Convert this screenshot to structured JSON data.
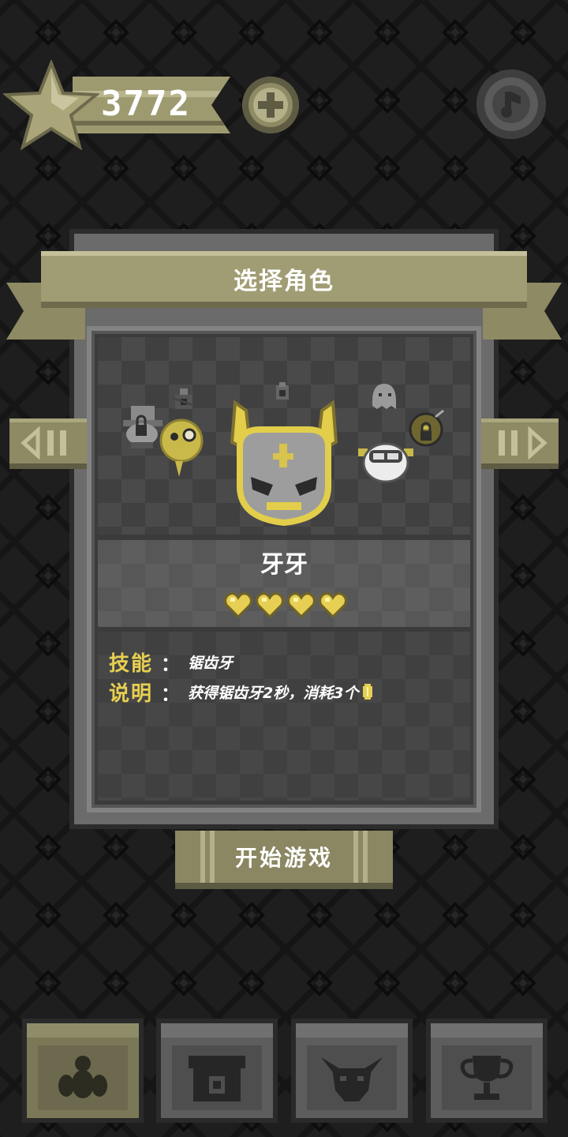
{
  "score": "3772",
  "dialog": {
    "title": "选择角色",
    "character_name": "牙牙",
    "hearts": 4,
    "skill_label": "技能",
    "skill_colon": "：",
    "skill_value": "锯齿牙",
    "desc_label": "说明",
    "desc_colon": "：",
    "desc_value": "获得锯齿牙2秒，消耗3个"
  },
  "start_button": "开始游戏",
  "icons": {
    "score": "star-icon",
    "add": "plus-icon",
    "sound": "sound-icon",
    "prev": "prev-arrow-icon",
    "next": "next-arrow-icon",
    "coin": "coin-icon",
    "tabs": [
      "characters-icon",
      "shop-icon",
      "bull-icon",
      "trophy-icon"
    ]
  },
  "colors": {
    "accent": "#e6cf52",
    "olive": "#8d8a64",
    "background": "#1e1e1e",
    "panel": "#6b6b6b"
  }
}
